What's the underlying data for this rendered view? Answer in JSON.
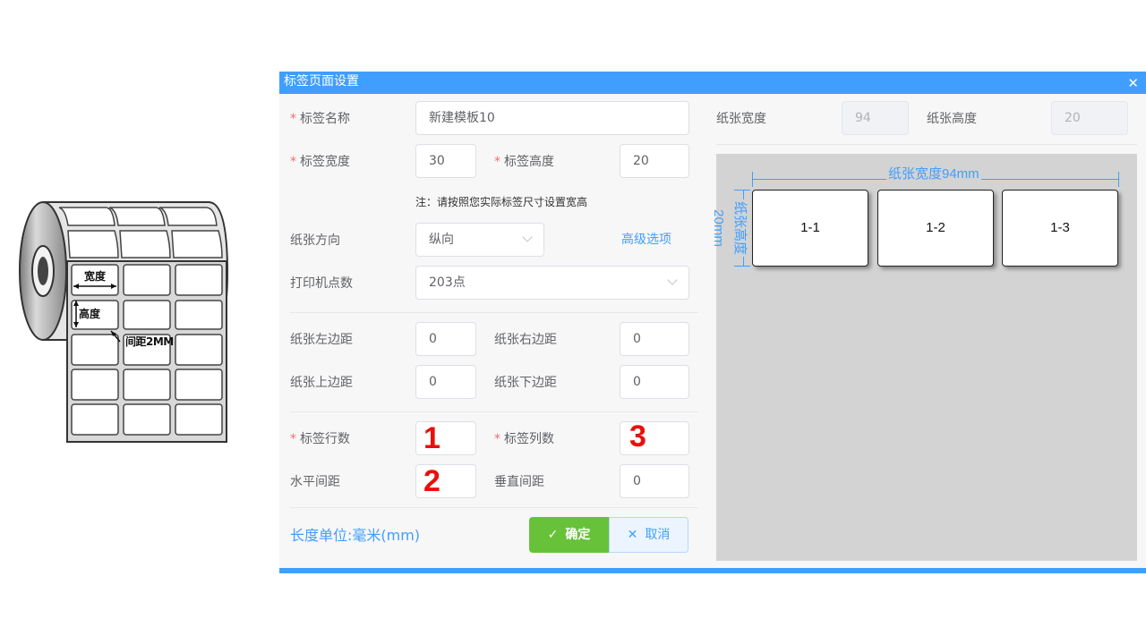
{
  "illustration": {
    "width_label": "宽度",
    "height_label": "高度",
    "gap_label": "间距2MM"
  },
  "dialog": {
    "title": "标签页面设置",
    "form": {
      "label_name": {
        "label": "标签名称",
        "value": "新建模板10"
      },
      "label_width": {
        "label": "标签宽度",
        "value": "30"
      },
      "label_height": {
        "label": "标签高度",
        "value": "20"
      },
      "note": "注：请按照您实际标签尺寸设置宽高",
      "paper_direction": {
        "label": "纸张方向",
        "value": "纵向"
      },
      "advanced_link": "高级选项",
      "printer_dpi": {
        "label": "打印机点数",
        "value": "203点"
      },
      "paper_left_margin": {
        "label": "纸张左边距",
        "value": "0"
      },
      "paper_right_margin": {
        "label": "纸张右边距",
        "value": "0"
      },
      "paper_top_margin": {
        "label": "纸张上边距",
        "value": "0"
      },
      "paper_bottom_margin": {
        "label": "纸张下边距",
        "value": "0"
      },
      "label_rows": {
        "label": "标签行数",
        "value": "1"
      },
      "label_cols": {
        "label": "标签列数",
        "value": "3"
      },
      "horizontal_gap": {
        "label": "水平间距",
        "value": "2"
      },
      "vertical_gap": {
        "label": "垂直间距",
        "value": "0"
      },
      "unit_text": "长度单位:毫米(mm)"
    },
    "buttons": {
      "ok": "确定",
      "cancel": "取消"
    },
    "paper": {
      "width_label": "纸张宽度",
      "width_value": "94",
      "height_label": "纸张高度",
      "height_value": "20"
    },
    "preview": {
      "width_dim": "纸张宽度94mm",
      "height_dim_vertical": "纸张高度",
      "height_dim_value": "20mm",
      "cells": [
        "1-1",
        "1-2",
        "1-3"
      ]
    }
  },
  "colors": {
    "primary": "#409eff",
    "success": "#67c23a",
    "required": "#f56c6c",
    "highlight_number": "#e8100c"
  }
}
